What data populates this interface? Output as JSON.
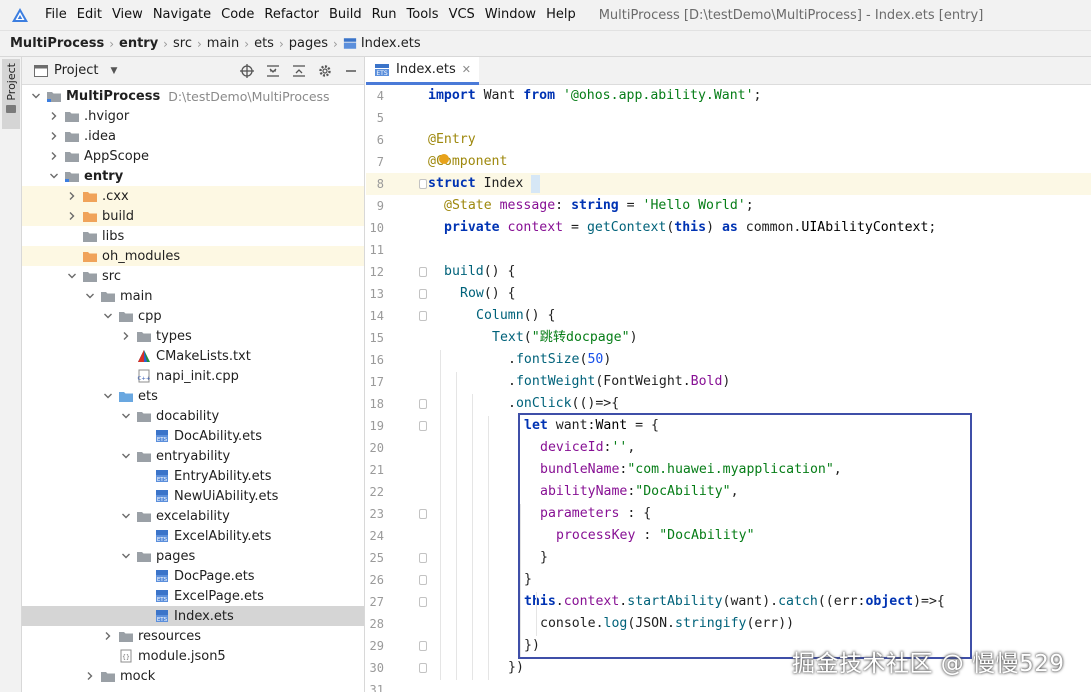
{
  "menubar": {
    "items": [
      "File",
      "Edit",
      "View",
      "Navigate",
      "Code",
      "Refactor",
      "Build",
      "Run",
      "Tools",
      "VCS",
      "Window",
      "Help"
    ],
    "window_title": "MultiProcess [D:\\testDemo\\MultiProcess] - Index.ets [entry]"
  },
  "breadcrumb": {
    "items": [
      "MultiProcess",
      "entry",
      "src",
      "main",
      "ets",
      "pages",
      "Index.ets"
    ]
  },
  "tool_strip": {
    "project_tab": "Project"
  },
  "project_panel": {
    "header_label": "Project",
    "tools": [
      "locate-icon",
      "expand-all-icon",
      "collapse-all-icon",
      "gear-icon",
      "minimize-icon"
    ],
    "tree": [
      {
        "label": "MultiProcess",
        "path": "D:\\testDemo\\MultiProcess",
        "depth": 0,
        "arrow": "down",
        "icon": "module",
        "bold": true
      },
      {
        "label": ".hvigor",
        "depth": 1,
        "arrow": "right",
        "icon": "folder"
      },
      {
        "label": ".idea",
        "depth": 1,
        "arrow": "right",
        "icon": "folder"
      },
      {
        "label": "AppScope",
        "depth": 1,
        "arrow": "right",
        "icon": "folder"
      },
      {
        "label": "entry",
        "depth": 1,
        "arrow": "down",
        "icon": "module",
        "bold": true
      },
      {
        "label": ".cxx",
        "depth": 2,
        "arrow": "right",
        "icon": "folder-orange",
        "highlight": true
      },
      {
        "label": "build",
        "depth": 2,
        "arrow": "right",
        "icon": "folder-orange",
        "highlight": true
      },
      {
        "label": "libs",
        "depth": 2,
        "arrow": "none",
        "icon": "folder"
      },
      {
        "label": "oh_modules",
        "depth": 2,
        "arrow": "none",
        "icon": "folder-orange",
        "highlight": true
      },
      {
        "label": "src",
        "depth": 2,
        "arrow": "down",
        "icon": "folder"
      },
      {
        "label": "main",
        "depth": 3,
        "arrow": "down",
        "icon": "folder"
      },
      {
        "label": "cpp",
        "depth": 4,
        "arrow": "down",
        "icon": "folder"
      },
      {
        "label": "types",
        "depth": 5,
        "arrow": "right",
        "icon": "folder"
      },
      {
        "label": "CMakeLists.txt",
        "depth": 5,
        "arrow": "none",
        "icon": "cmake"
      },
      {
        "label": "napi_init.cpp",
        "depth": 5,
        "arrow": "none",
        "icon": "cpp"
      },
      {
        "label": "ets",
        "depth": 4,
        "arrow": "down",
        "icon": "folder-blue"
      },
      {
        "label": "docability",
        "depth": 5,
        "arrow": "down",
        "icon": "folder"
      },
      {
        "label": "DocAbility.ets",
        "depth": 6,
        "arrow": "none",
        "icon": "ets"
      },
      {
        "label": "entryability",
        "depth": 5,
        "arrow": "down",
        "icon": "folder"
      },
      {
        "label": "EntryAbility.ets",
        "depth": 6,
        "arrow": "none",
        "icon": "ets"
      },
      {
        "label": "NewUiAbility.ets",
        "depth": 6,
        "arrow": "none",
        "icon": "ets"
      },
      {
        "label": "excelability",
        "depth": 5,
        "arrow": "down",
        "icon": "folder"
      },
      {
        "label": "ExcelAbility.ets",
        "depth": 6,
        "arrow": "none",
        "icon": "ets"
      },
      {
        "label": "pages",
        "depth": 5,
        "arrow": "down",
        "icon": "folder"
      },
      {
        "label": "DocPage.ets",
        "depth": 6,
        "arrow": "none",
        "icon": "ets"
      },
      {
        "label": "ExcelPage.ets",
        "depth": 6,
        "arrow": "none",
        "icon": "ets"
      },
      {
        "label": "Index.ets",
        "depth": 6,
        "arrow": "none",
        "icon": "ets",
        "selected": true
      },
      {
        "label": "resources",
        "depth": 4,
        "arrow": "right",
        "icon": "folder"
      },
      {
        "label": "module.json5",
        "depth": 4,
        "arrow": "none",
        "icon": "json"
      },
      {
        "label": "mock",
        "depth": 3,
        "arrow": "right",
        "icon": "folder"
      }
    ]
  },
  "editor": {
    "tab_label": "Index.ets",
    "lines": [
      {
        "n": "4",
        "indent": 0,
        "tokens": [
          [
            "kw",
            "import"
          ],
          [
            "",
            " Want "
          ],
          [
            "kw",
            "from"
          ],
          [
            "str",
            " '@ohos.app.ability.Want'"
          ],
          [
            "",
            ";"
          ]
        ]
      },
      {
        "n": "5",
        "indent": 0,
        "tokens": []
      },
      {
        "n": "6",
        "indent": 0,
        "tokens": [
          [
            "ann",
            "@Entry"
          ]
        ]
      },
      {
        "n": "7",
        "indent": 0,
        "tokens": [
          [
            "ann",
            "@Component"
          ]
        ]
      },
      {
        "n": "8",
        "indent": 0,
        "current": true,
        "tokens": [
          [
            "kw",
            "struct"
          ],
          [
            "",
            " Index "
          ],
          [
            "brace",
            "{"
          ]
        ]
      },
      {
        "n": "9",
        "indent": 1,
        "tokens": [
          [
            "ann",
            "@State"
          ],
          [
            "",
            " "
          ],
          [
            "prop",
            "message"
          ],
          [
            "",
            ": "
          ],
          [
            "kw",
            "string"
          ],
          [
            "",
            " = "
          ],
          [
            "str",
            "'Hello World'"
          ],
          [
            "",
            ";"
          ]
        ]
      },
      {
        "n": "10",
        "indent": 1,
        "tokens": [
          [
            "kw",
            "private"
          ],
          [
            "",
            " "
          ],
          [
            "prop",
            "context"
          ],
          [
            "",
            " = "
          ],
          [
            "fn",
            "getContext"
          ],
          [
            "",
            "("
          ],
          [
            "kw",
            "this"
          ],
          [
            "",
            ") "
          ],
          [
            "kw",
            "as"
          ],
          [
            "",
            " common."
          ],
          [
            "ty",
            "UIAbilityContext"
          ],
          [
            "",
            ";"
          ]
        ]
      },
      {
        "n": "11",
        "indent": 0,
        "tokens": []
      },
      {
        "n": "12",
        "indent": 1,
        "tokens": [
          [
            "fn",
            "build"
          ],
          [
            "",
            "() {"
          ]
        ]
      },
      {
        "n": "13",
        "indent": 2,
        "tokens": [
          [
            "fn",
            "Row"
          ],
          [
            "",
            "() {"
          ]
        ]
      },
      {
        "n": "14",
        "indent": 3,
        "tokens": [
          [
            "fn",
            "Column"
          ],
          [
            "",
            "() {"
          ]
        ]
      },
      {
        "n": "15",
        "indent": 4,
        "tokens": [
          [
            "fn",
            "Text"
          ],
          [
            "",
            "("
          ],
          [
            "str",
            "\"跳转docpage\""
          ],
          [
            "",
            ")"
          ]
        ]
      },
      {
        "n": "16",
        "indent": 5,
        "tokens": [
          [
            "",
            "."
          ],
          [
            "fn",
            "fontSize"
          ],
          [
            "",
            "("
          ],
          [
            "num",
            "50"
          ],
          [
            "",
            ")"
          ]
        ]
      },
      {
        "n": "17",
        "indent": 5,
        "tokens": [
          [
            "",
            "."
          ],
          [
            "fn",
            "fontWeight"
          ],
          [
            "",
            "(FontWeight."
          ],
          [
            "prop",
            "Bold"
          ],
          [
            "",
            ")"
          ]
        ]
      },
      {
        "n": "18",
        "indent": 5,
        "tokens": [
          [
            "",
            "."
          ],
          [
            "fn",
            "onClick"
          ],
          [
            "",
            "(()=>{"
          ]
        ]
      },
      {
        "n": "19",
        "indent": 6,
        "tokens": [
          [
            "kw",
            "let"
          ],
          [
            "",
            " want:"
          ],
          [
            "ty",
            "Want"
          ],
          [
            "",
            " = {"
          ]
        ]
      },
      {
        "n": "20",
        "indent": 7,
        "tokens": [
          [
            "prop",
            "deviceId"
          ],
          [
            "",
            ":"
          ],
          [
            "str",
            "''"
          ],
          [
            "",
            ","
          ]
        ]
      },
      {
        "n": "21",
        "indent": 7,
        "tokens": [
          [
            "prop",
            "bundleName"
          ],
          [
            "",
            ":"
          ],
          [
            "str",
            "\"com.huawei.myapplication\""
          ],
          [
            "",
            ","
          ]
        ]
      },
      {
        "n": "22",
        "indent": 7,
        "tokens": [
          [
            "prop",
            "abilityName"
          ],
          [
            "",
            ":"
          ],
          [
            "str",
            "\"DocAbility\""
          ],
          [
            "",
            ","
          ]
        ]
      },
      {
        "n": "23",
        "indent": 7,
        "tokens": [
          [
            "prop",
            "parameters"
          ],
          [
            "",
            " : {"
          ]
        ]
      },
      {
        "n": "24",
        "indent": 8,
        "tokens": [
          [
            "prop",
            "processKey"
          ],
          [
            "",
            " : "
          ],
          [
            "str",
            "\"DocAbility\""
          ]
        ]
      },
      {
        "n": "25",
        "indent": 7,
        "tokens": [
          [
            "",
            "}"
          ]
        ]
      },
      {
        "n": "26",
        "indent": 6,
        "tokens": [
          [
            "",
            "}"
          ]
        ]
      },
      {
        "n": "27",
        "indent": 6,
        "tokens": [
          [
            "kw",
            "this"
          ],
          [
            "",
            "."
          ],
          [
            "prop",
            "context"
          ],
          [
            "",
            "."
          ],
          [
            "fn",
            "startAbility"
          ],
          [
            "",
            "(want)."
          ],
          [
            "fn",
            "catch"
          ],
          [
            "",
            "((err:"
          ],
          [
            "kw",
            "object"
          ],
          [
            "",
            ")=>{"
          ]
        ]
      },
      {
        "n": "28",
        "indent": 7,
        "tokens": [
          [
            "",
            "console."
          ],
          [
            "fn",
            "log"
          ],
          [
            "",
            "(JSON."
          ],
          [
            "fn",
            "stringify"
          ],
          [
            "",
            "(err))"
          ]
        ]
      },
      {
        "n": "29",
        "indent": 6,
        "tokens": [
          [
            "",
            "})"
          ]
        ]
      },
      {
        "n": "30",
        "indent": 5,
        "tokens": [
          [
            "",
            "})"
          ]
        ]
      },
      {
        "n": "31",
        "indent": 0,
        "tokens": []
      }
    ]
  },
  "watermark": "掘金技术社区 @ 慢慢529",
  "colors": {
    "accent": "#4a7ad8",
    "highlight_box": "#3f4fa8",
    "folder": "#9aa0a6",
    "folder_orange": "#f0a35a",
    "folder_blue": "#69a7e0"
  }
}
